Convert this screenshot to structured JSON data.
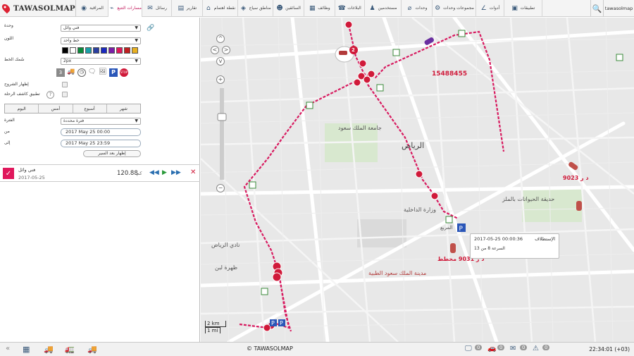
{
  "app": {
    "brand": "TAWASOLMAP",
    "user": "tawasolmap"
  },
  "nav": [
    {
      "label": "المراقبة",
      "icon": "eye-icon"
    },
    {
      "label": "مسارات التتبع",
      "icon": "tracks-icon",
      "active": true
    },
    {
      "label": "رسائل",
      "icon": "messages-icon"
    },
    {
      "label": "تقارير",
      "icon": "reports-icon"
    },
    {
      "label": "نقطة اهتمام",
      "icon": "poi-icon"
    },
    {
      "label": "مناطق سياج",
      "icon": "geofence-icon"
    },
    {
      "label": "السائقين",
      "icon": "driver-icon"
    },
    {
      "label": "وظائف",
      "icon": "jobs-icon"
    },
    {
      "label": "البلاغات",
      "icon": "notifications-icon"
    },
    {
      "label": "مستخدمين",
      "icon": "users-icon"
    },
    {
      "label": "وحدات",
      "icon": "units-icon"
    },
    {
      "label": "مجموعات وحدات",
      "icon": "unit-groups-icon"
    },
    {
      "label": "أدوات",
      "icon": "tools-icon"
    },
    {
      "label": "تطبيقات",
      "icon": "apps-icon"
    }
  ],
  "panel": {
    "unit_label": "وحدة",
    "unit_value": "فني وائل",
    "color_label": "اللون",
    "color_value": "خط واحد",
    "swatches": [
      "#000000",
      "#ffffff",
      "#0a8a3a",
      "#1aa0a8",
      "#2a3fa0",
      "#1b2ac0",
      "#7a1fa8",
      "#e0185c",
      "#c02020",
      "#e8b020"
    ],
    "thickness_label": "سُمك الخط",
    "thickness_value": "2px",
    "show_trips_label": "إظهار الشروح",
    "follow_label": "تطبيق كاشف الرحلة",
    "tabs": [
      "اليوم",
      "أمس",
      "أسبوع",
      "شهر"
    ],
    "period_label": "الفترة",
    "period_value": "فترة محددة",
    "from_label": "من",
    "from_value": "2017 May 25 00:00",
    "to_label": "إلى",
    "to_value": "2017 May 25 23:59",
    "show_button": "إظهار بعد السير",
    "trip": {
      "name": "فني وائل",
      "date": "2017-05-25",
      "distance": "120.88",
      "unit": "كم"
    }
  },
  "map": {
    "labels": {
      "riyadh": "الرياض",
      "university": "جامعة الملك سعود",
      "ministry": "وزارة الداخلية",
      "club": "نادي الرياض",
      "zoo": "حديقة الحيوانات بالملز",
      "medical": "مدينة الملك سعود الطبية",
      "district": "ظهرة لبن",
      "murabba": "المربع"
    },
    "plates": [
      "15488455",
      "د ر 9023",
      "د ر 9031 مخطط"
    ],
    "badge": "2",
    "popup": {
      "title": "الإستطلاف",
      "time": "2017-05-25 00:00:36",
      "speed": "السرعة 8 من 13"
    },
    "scale_km": "2 km",
    "scale_mi": "1 mi"
  },
  "bottom": {
    "copyright": "© TAWASOLMAP",
    "clock": "22:34:01 (+03)",
    "counts": [
      "0",
      "0",
      "0",
      "0"
    ]
  },
  "colors": {
    "accent": "#e0185c",
    "track": "#d81b60",
    "nav_icon": "#3b5a7a"
  }
}
